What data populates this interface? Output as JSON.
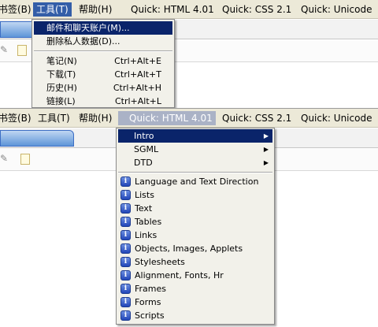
{
  "top": {
    "menubar": [
      {
        "label": "书签(B)"
      },
      {
        "label": "工具(T)"
      },
      {
        "label": "帮助(H)"
      },
      {
        "label": "Quick: HTML 4.01"
      },
      {
        "label": "Quick: CSS 2.1"
      },
      {
        "label": "Quick: Unicode"
      }
    ],
    "tools_menu": {
      "items": [
        {
          "label": "邮件和聊天账户(M)...",
          "shortcut": ""
        },
        {
          "label": "删除私人数据(D)...",
          "shortcut": ""
        },
        {
          "label": "笔记(N)",
          "shortcut": "Ctrl+Alt+E"
        },
        {
          "label": "下载(T)",
          "shortcut": "Ctrl+Alt+T"
        },
        {
          "label": "历史(H)",
          "shortcut": "Ctrl+Alt+H"
        },
        {
          "label": "链接(L)",
          "shortcut": "Ctrl+Alt+L"
        }
      ]
    }
  },
  "bottom": {
    "menubar": [
      {
        "label": "书签(B)"
      },
      {
        "label": "工具(T)"
      },
      {
        "label": "帮助(H)"
      },
      {
        "label": "Quick: HTML 4.01"
      },
      {
        "label": "Quick: CSS 2.1"
      },
      {
        "label": "Quick: Unicode"
      }
    ],
    "html_menu": {
      "submenus": [
        {
          "label": "Intro"
        },
        {
          "label": "SGML"
        },
        {
          "label": "DTD"
        }
      ],
      "items": [
        {
          "label": "Language and Text Direction"
        },
        {
          "label": "Lists"
        },
        {
          "label": "Text"
        },
        {
          "label": "Tables"
        },
        {
          "label": "Links"
        },
        {
          "label": "Objects, Images, Applets"
        },
        {
          "label": "Stylesheets"
        },
        {
          "label": "Alignment, Fonts, Hr"
        },
        {
          "label": "Frames"
        },
        {
          "label": "Forms"
        },
        {
          "label": "Scripts"
        }
      ],
      "item_icon": "info-icon",
      "submenu_arrow": "arrow-right-icon"
    }
  },
  "colors": {
    "menu_highlight": "#0a246a",
    "menubar_active": "#335ea8",
    "menu_bg": "#f2f1ea",
    "menubar_bg": "#ece9d8"
  }
}
